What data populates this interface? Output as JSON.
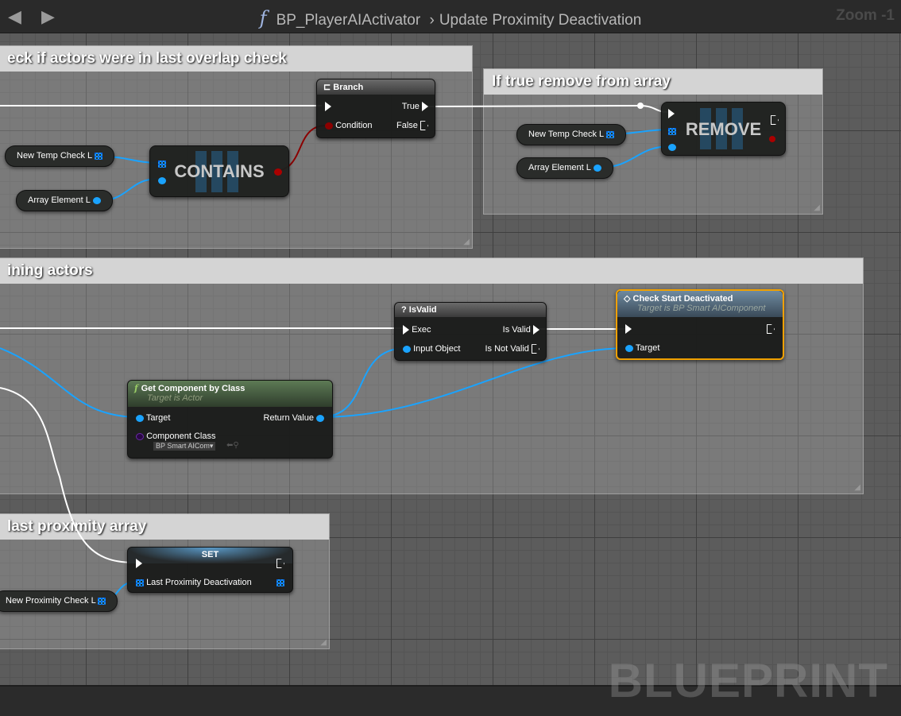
{
  "header": {
    "back": "◀",
    "forward": "▶",
    "func_icon": "f",
    "blueprint": "BP_PlayerAIActivator",
    "separator": "›",
    "function": "Update Proximity Deactivation",
    "zoom": "Zoom -1"
  },
  "comments": [
    {
      "title": "eck if actors were in last overlap check"
    },
    {
      "title": "If true remove from array"
    },
    {
      "title": "ining actors"
    },
    {
      "title": "last proximity array"
    }
  ],
  "nodes": {
    "branch": {
      "title": "Branch",
      "true": "True",
      "false": "False",
      "condition": "Condition"
    },
    "contains": {
      "title": "CONTAINS"
    },
    "remove": {
      "title": "REMOVE"
    },
    "isvalid": {
      "title": "IsValid",
      "exec": "Exec",
      "input": "Input Object",
      "is_valid": "Is Valid",
      "is_not_valid": "Is Not Valid"
    },
    "check": {
      "title": "Check Start Deactivated",
      "subtitle": "Target is BP Smart AIComponent",
      "target": "Target"
    },
    "getcomp": {
      "title": "Get Component by Class",
      "subtitle": "Target is Actor",
      "target": "Target",
      "return": "Return Value",
      "class_label": "Component Class",
      "class_value": "BP Smart AICom"
    },
    "set": {
      "title": "SET",
      "var": "Last Proximity Deactivation"
    }
  },
  "variables": {
    "temp1": "New Temp Check L",
    "elem1": "Array Element L",
    "temp2": "New Temp Check L",
    "elem2": "Array Element L",
    "prox": "New Proximity Check L"
  },
  "watermark": "BLUEPRINT"
}
